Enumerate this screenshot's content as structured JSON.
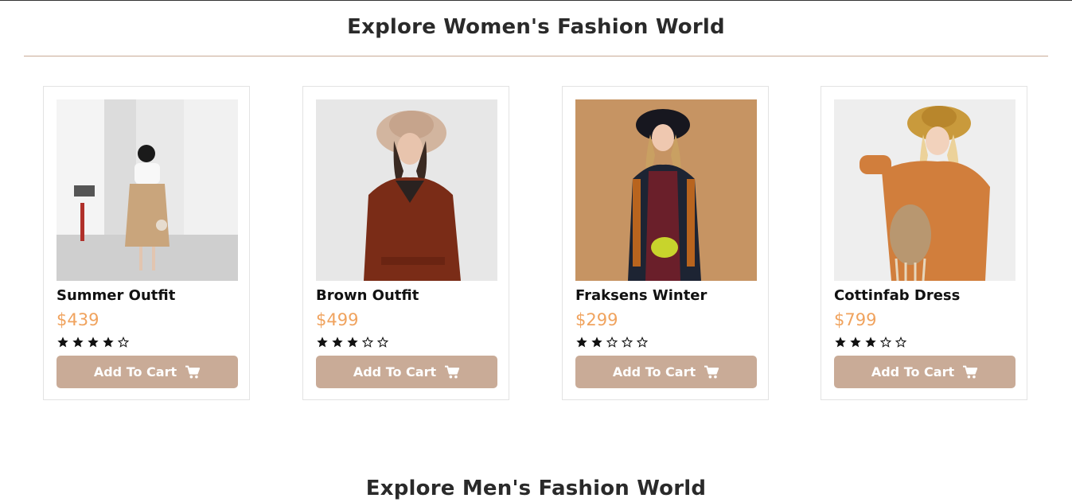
{
  "sections": {
    "women_title": "Explore Women's Fashion World",
    "men_title": "Explore Men's Fashion World"
  },
  "colors": {
    "accent": "#c9ab97",
    "price": "#f0a35e",
    "star": "#111111"
  },
  "products": [
    {
      "name": "Summer Outfit",
      "price": "$439",
      "rating": 4,
      "max_rating": 5,
      "button_label": "Add To Cart",
      "image": "woman-white-blouse-beige-skirt"
    },
    {
      "name": "Brown Outfit",
      "price": "$499",
      "rating": 3,
      "max_rating": 5,
      "button_label": "Add To Cart",
      "image": "woman-brown-coat-hat"
    },
    {
      "name": "Fraksens Winter",
      "price": "$299",
      "rating": 2,
      "max_rating": 5,
      "button_label": "Add To Cart",
      "image": "woman-dark-cardigan-hat"
    },
    {
      "name": "Cottinfab Dress",
      "price": "$799",
      "rating": 3,
      "max_rating": 5,
      "button_label": "Add To Cart",
      "image": "woman-orange-dress-straw-hat"
    }
  ]
}
